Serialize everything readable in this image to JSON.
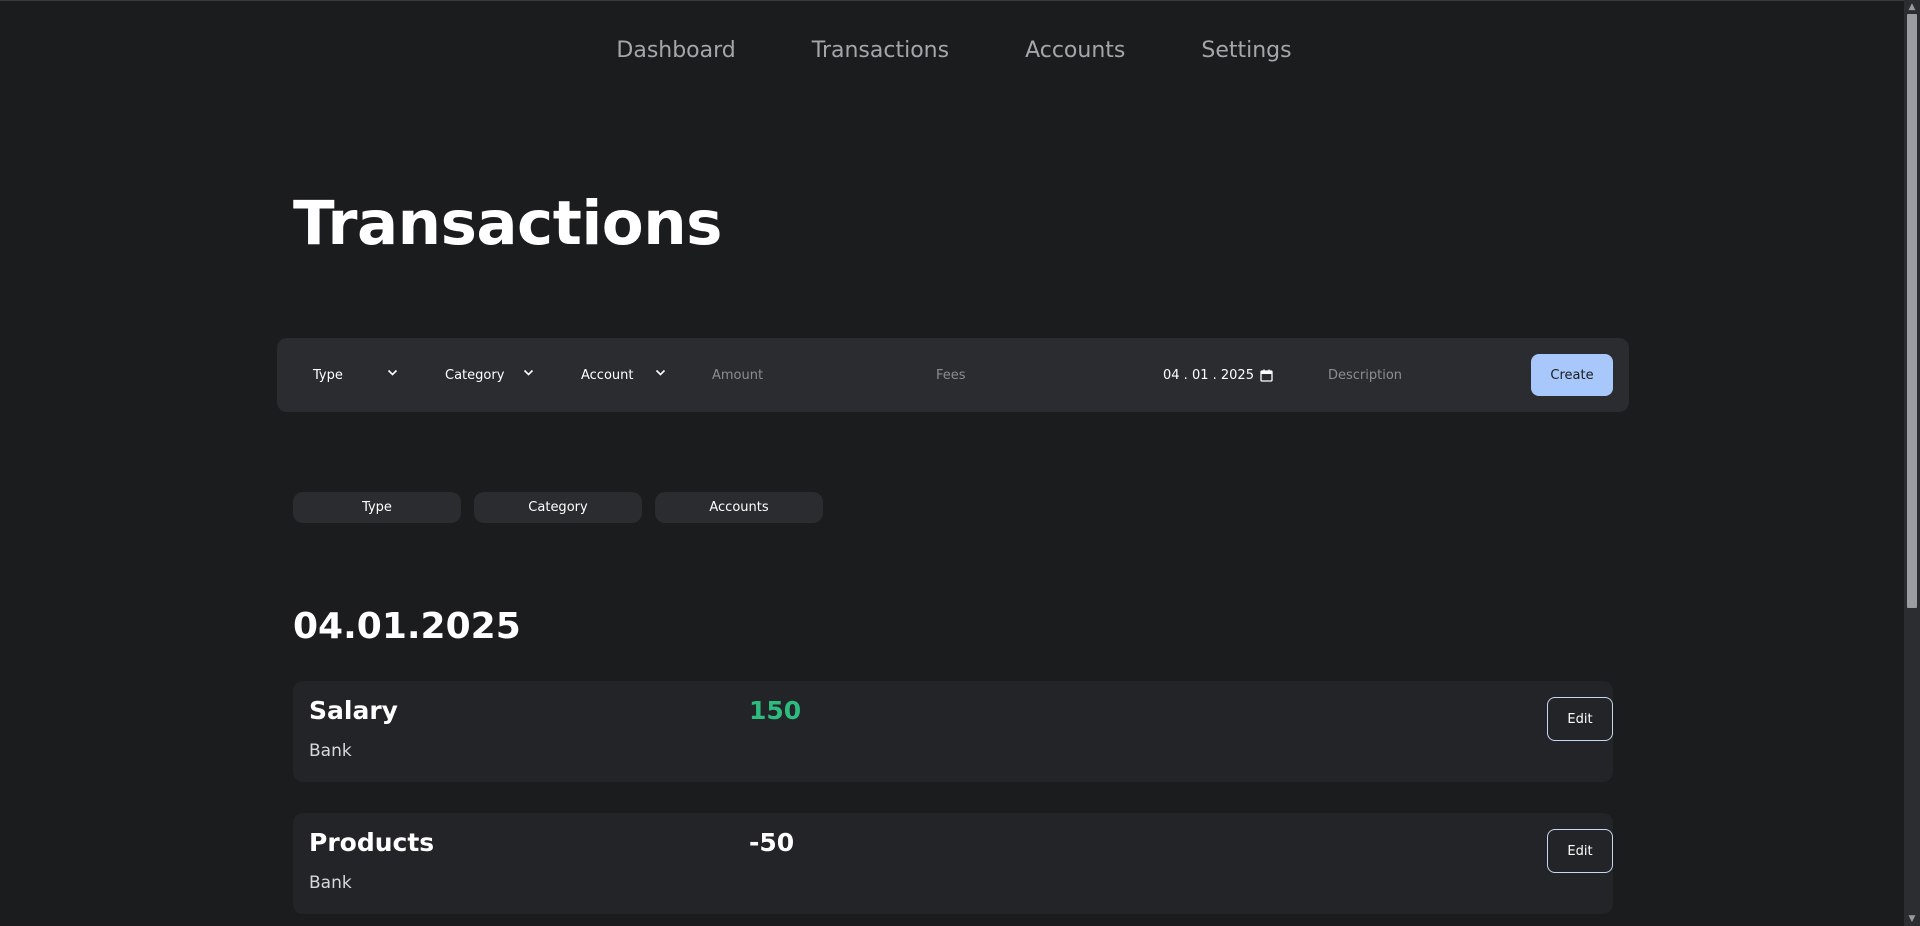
{
  "nav": {
    "items": [
      "Dashboard",
      "Transactions",
      "Accounts",
      "Settings"
    ]
  },
  "page": {
    "title": "Transactions"
  },
  "form": {
    "type_label": "Type",
    "category_label": "Category",
    "account_label": "Account",
    "amount_placeholder": "Amount",
    "fees_placeholder": "Fees",
    "date_value": "04 . 01 . 2025",
    "description_placeholder": "Description",
    "create_label": "Create"
  },
  "filters": [
    "Type",
    "Category",
    "Accounts"
  ],
  "groups": [
    {
      "date": "04.01.2025",
      "transactions": [
        {
          "category": "Salary",
          "account": "Bank",
          "amount": "150",
          "amount_color": "#2dbb7f",
          "edit_label": "Edit"
        },
        {
          "category": "Products",
          "account": "Bank",
          "amount": "-50",
          "amount_color": "#ffffff",
          "edit_label": "Edit"
        }
      ]
    }
  ],
  "colors": {
    "background": "#1b1c1e",
    "panel": "#2a2c2f",
    "card": "#232427",
    "accent": "#a8c8fb",
    "positive": "#2dbb7f"
  }
}
